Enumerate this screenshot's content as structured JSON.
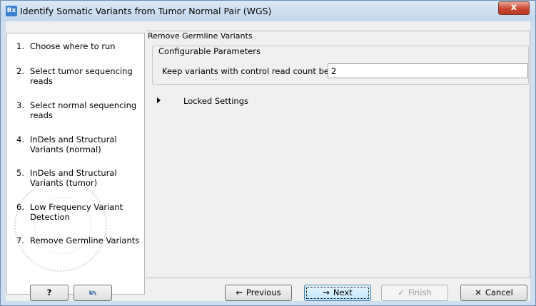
{
  "window": {
    "app_icon_text": "Bx",
    "title": "Identify Somatic Variants from Tumor Normal Pair (WGS)",
    "close_label": "x"
  },
  "steps": [
    {
      "num": "1.",
      "label": "Choose where to run"
    },
    {
      "num": "2.",
      "label": "Select tumor sequencing reads"
    },
    {
      "num": "3.",
      "label": "Select normal sequencing reads"
    },
    {
      "num": "4.",
      "label": "InDels and Structural Variants (normal)"
    },
    {
      "num": "5.",
      "label": "InDels and Structural Variants (tumor)"
    },
    {
      "num": "6.",
      "label": "Low Frequency Variant Detection"
    },
    {
      "num": "7.",
      "label": "Remove Germline Variants"
    }
  ],
  "panel": {
    "title": "Remove Germline Variants",
    "group_title": "Configurable Parameters",
    "param_label": "Keep variants with control read count below",
    "param_value": "2",
    "locked_label": "Locked Settings"
  },
  "buttons": {
    "help": "?",
    "reset_icon": "undo-icon",
    "previous": "Previous",
    "next": "Next",
    "finish": "Finish",
    "cancel": "Cancel"
  },
  "colors": {
    "title_bar": "#c3d6ec",
    "close_button": "#c8452f",
    "default_button": "#bee6fd"
  }
}
